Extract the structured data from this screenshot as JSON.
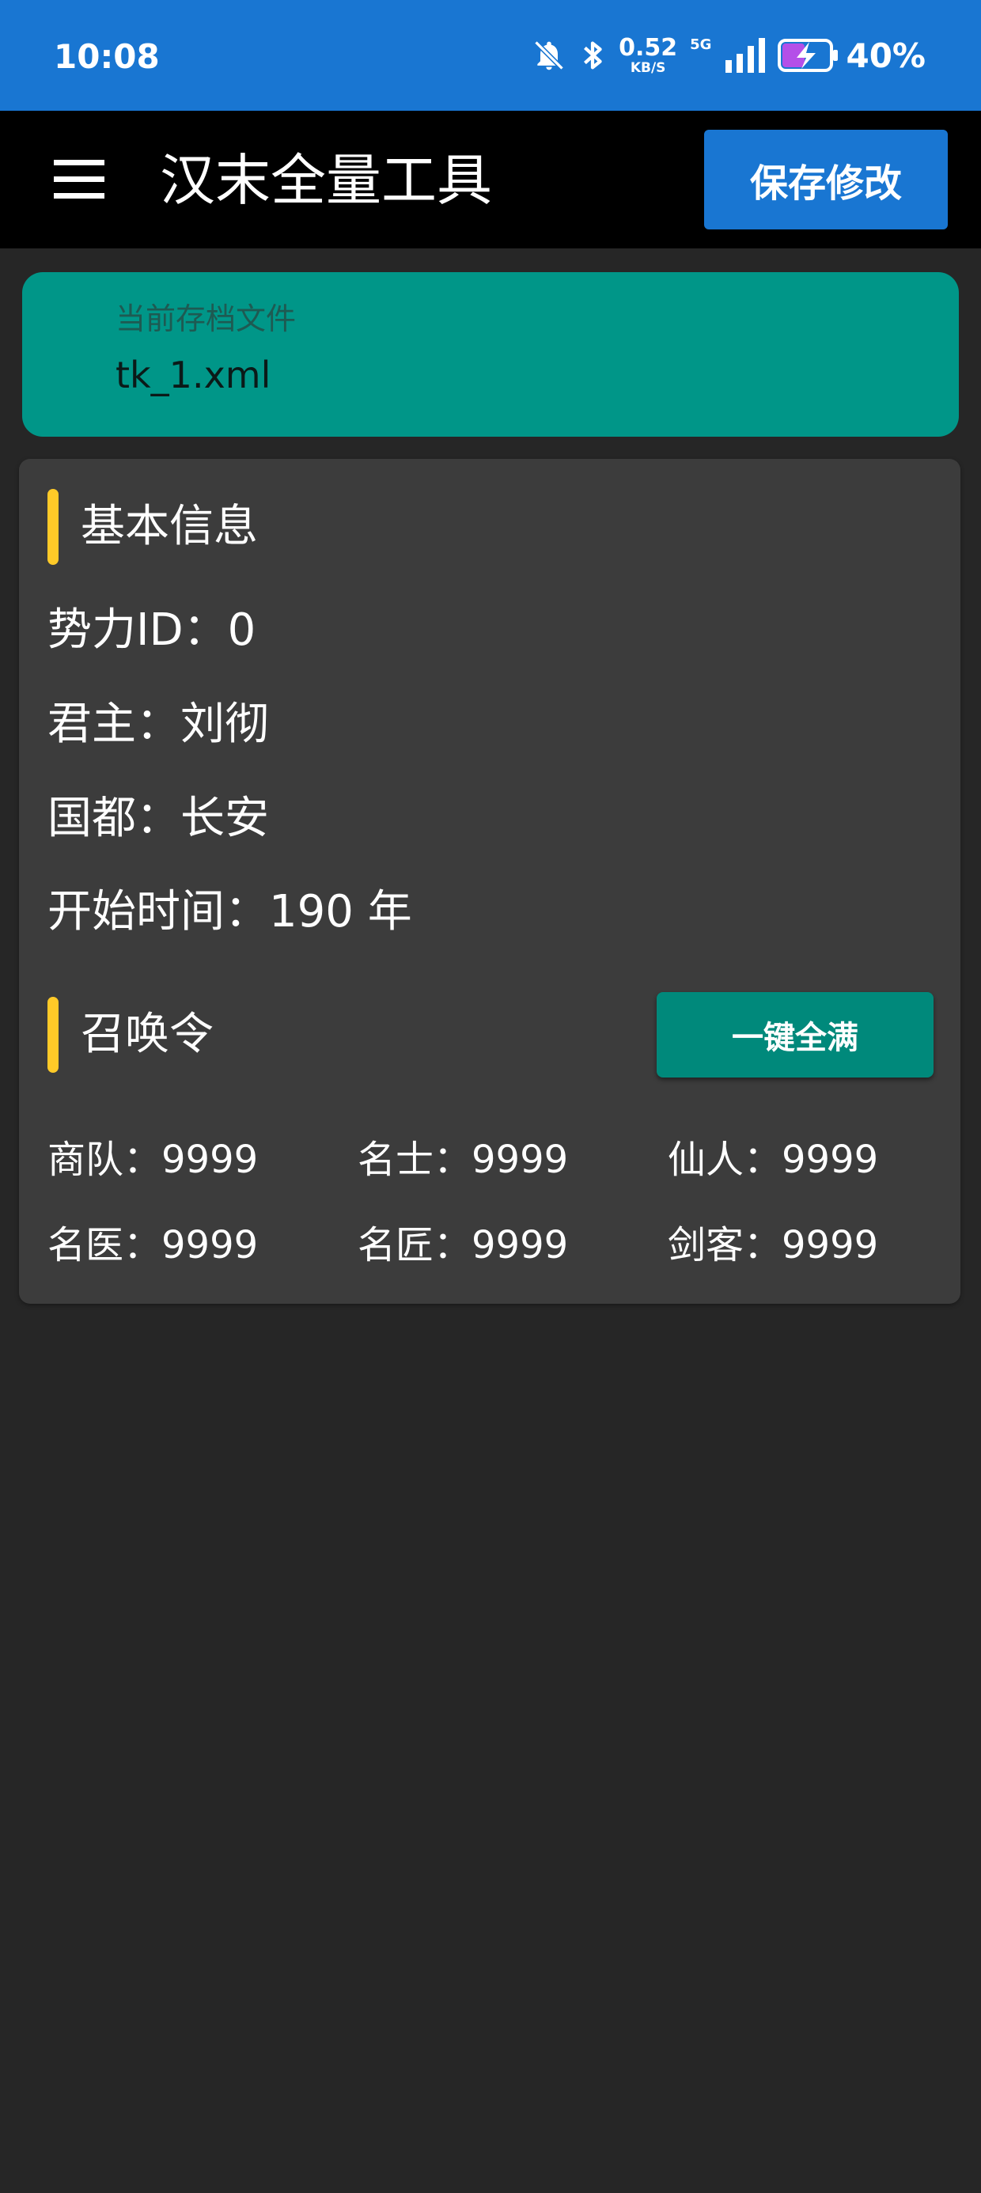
{
  "status_bar": {
    "time": "10:08",
    "net_speed_value": "0.52",
    "net_speed_unit": "KB/S",
    "net_type": "5G",
    "battery_percent": "40%",
    "icons": [
      "bell-muted-icon",
      "bluetooth-icon",
      "signal-icon",
      "battery-charging-icon"
    ]
  },
  "app_bar": {
    "title": "汉末全量工具",
    "save_label": "保存修改",
    "menu_icon": "hamburger-menu-icon"
  },
  "file_card": {
    "caption": "当前存档文件",
    "filename": "tk_1.xml"
  },
  "basic_info": {
    "title": "基本信息",
    "faction_id": {
      "label": "势力ID：",
      "value": "0"
    },
    "ruler": {
      "label": "君主：",
      "value": "刘彻"
    },
    "capital": {
      "label": "国都：",
      "value": "长安"
    },
    "start_time": {
      "label": "开始时间：",
      "value": "190 年"
    }
  },
  "summon": {
    "title": "召唤令",
    "fill_all_label": "一键全满",
    "items": [
      {
        "label": "商队：",
        "value": "9999"
      },
      {
        "label": "名士：",
        "value": "9999"
      },
      {
        "label": "仙人：",
        "value": "9999"
      },
      {
        "label": "名医：",
        "value": "9999"
      },
      {
        "label": "名匠：",
        "value": "9999"
      },
      {
        "label": "剑客：",
        "value": "9999"
      }
    ]
  },
  "colors": {
    "status_bar": "#1976d2",
    "app_bar": "#000000",
    "save_button": "#1976d2",
    "file_card": "#009688",
    "card_bg": "#3c3c3c",
    "page_bg": "#262626",
    "accent": "#ffca28",
    "fill_button": "#00897b"
  }
}
